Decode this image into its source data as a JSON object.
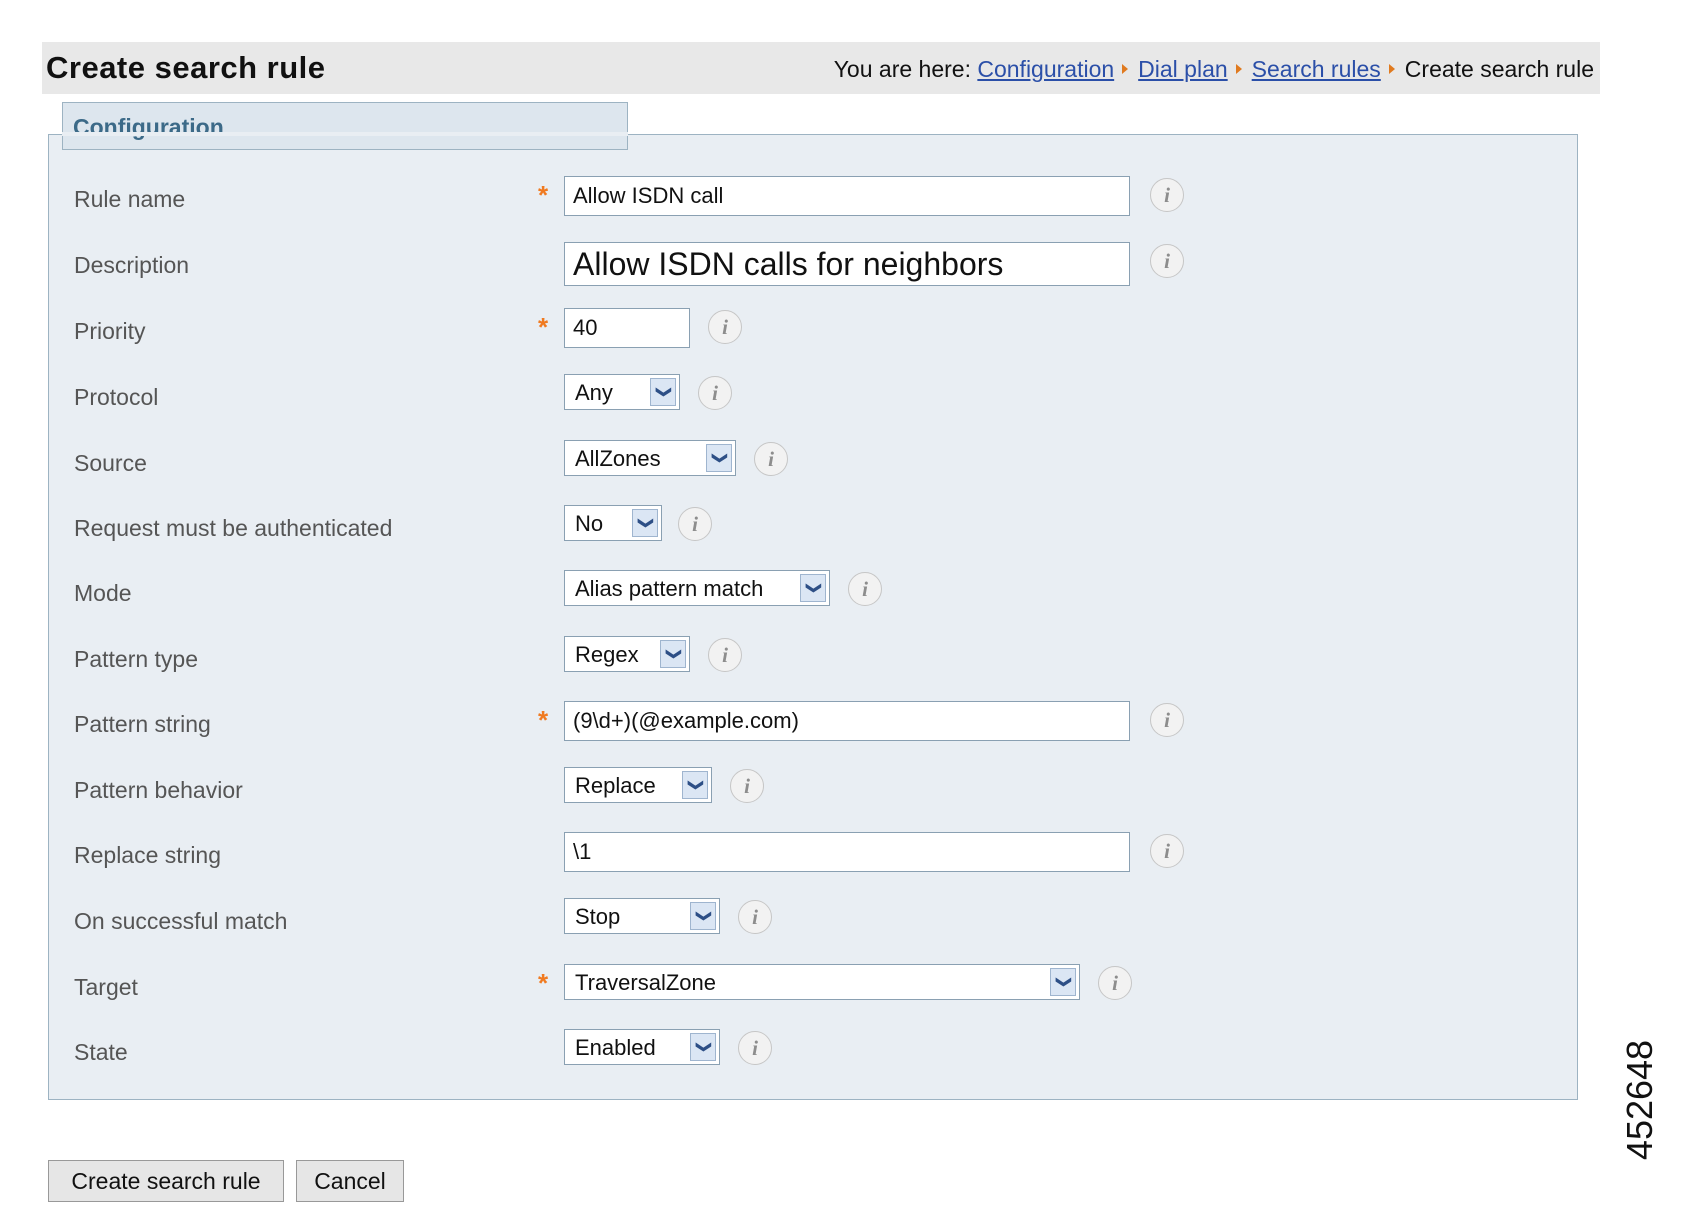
{
  "header": {
    "title": "Create search rule",
    "breadcrumb_prefix": "You are here:",
    "crumbs": [
      "Configuration",
      "Dial plan",
      "Search rules"
    ],
    "current": "Create search rule"
  },
  "section": {
    "title": "Configuration"
  },
  "form": {
    "rule_name": {
      "label": "Rule name",
      "value": "Allow ISDN call",
      "required": true
    },
    "description": {
      "label": "Description",
      "value": "Allow ISDN calls for neighbors"
    },
    "priority": {
      "label": "Priority",
      "value": "40",
      "required": true
    },
    "protocol": {
      "label": "Protocol",
      "value": "Any"
    },
    "source": {
      "label": "Source",
      "value": "AllZones"
    },
    "auth": {
      "label": "Request must be authenticated",
      "value": "No"
    },
    "mode": {
      "label": "Mode",
      "value": "Alias pattern match"
    },
    "pattern_type": {
      "label": "Pattern type",
      "value": "Regex"
    },
    "pattern_string": {
      "label": "Pattern string",
      "value": "(9\\d+)(@example.com)",
      "required": true
    },
    "pattern_behavior": {
      "label": "Pattern behavior",
      "value": "Replace"
    },
    "replace_string": {
      "label": "Replace string",
      "value": "\\1"
    },
    "on_match": {
      "label": "On successful match",
      "value": "Stop"
    },
    "target": {
      "label": "Target",
      "value": "TraversalZone",
      "required": true
    },
    "state": {
      "label": "State",
      "value": "Enabled"
    }
  },
  "required_marker": "*",
  "info_glyph": "i",
  "dropdown_glyph": "❯",
  "buttons": {
    "create": "Create search rule",
    "cancel": "Cancel"
  },
  "figure_id": "452648",
  "colors": {
    "required": "#f07a20",
    "link": "#2b4fa8",
    "section_title": "#3c6a88"
  }
}
